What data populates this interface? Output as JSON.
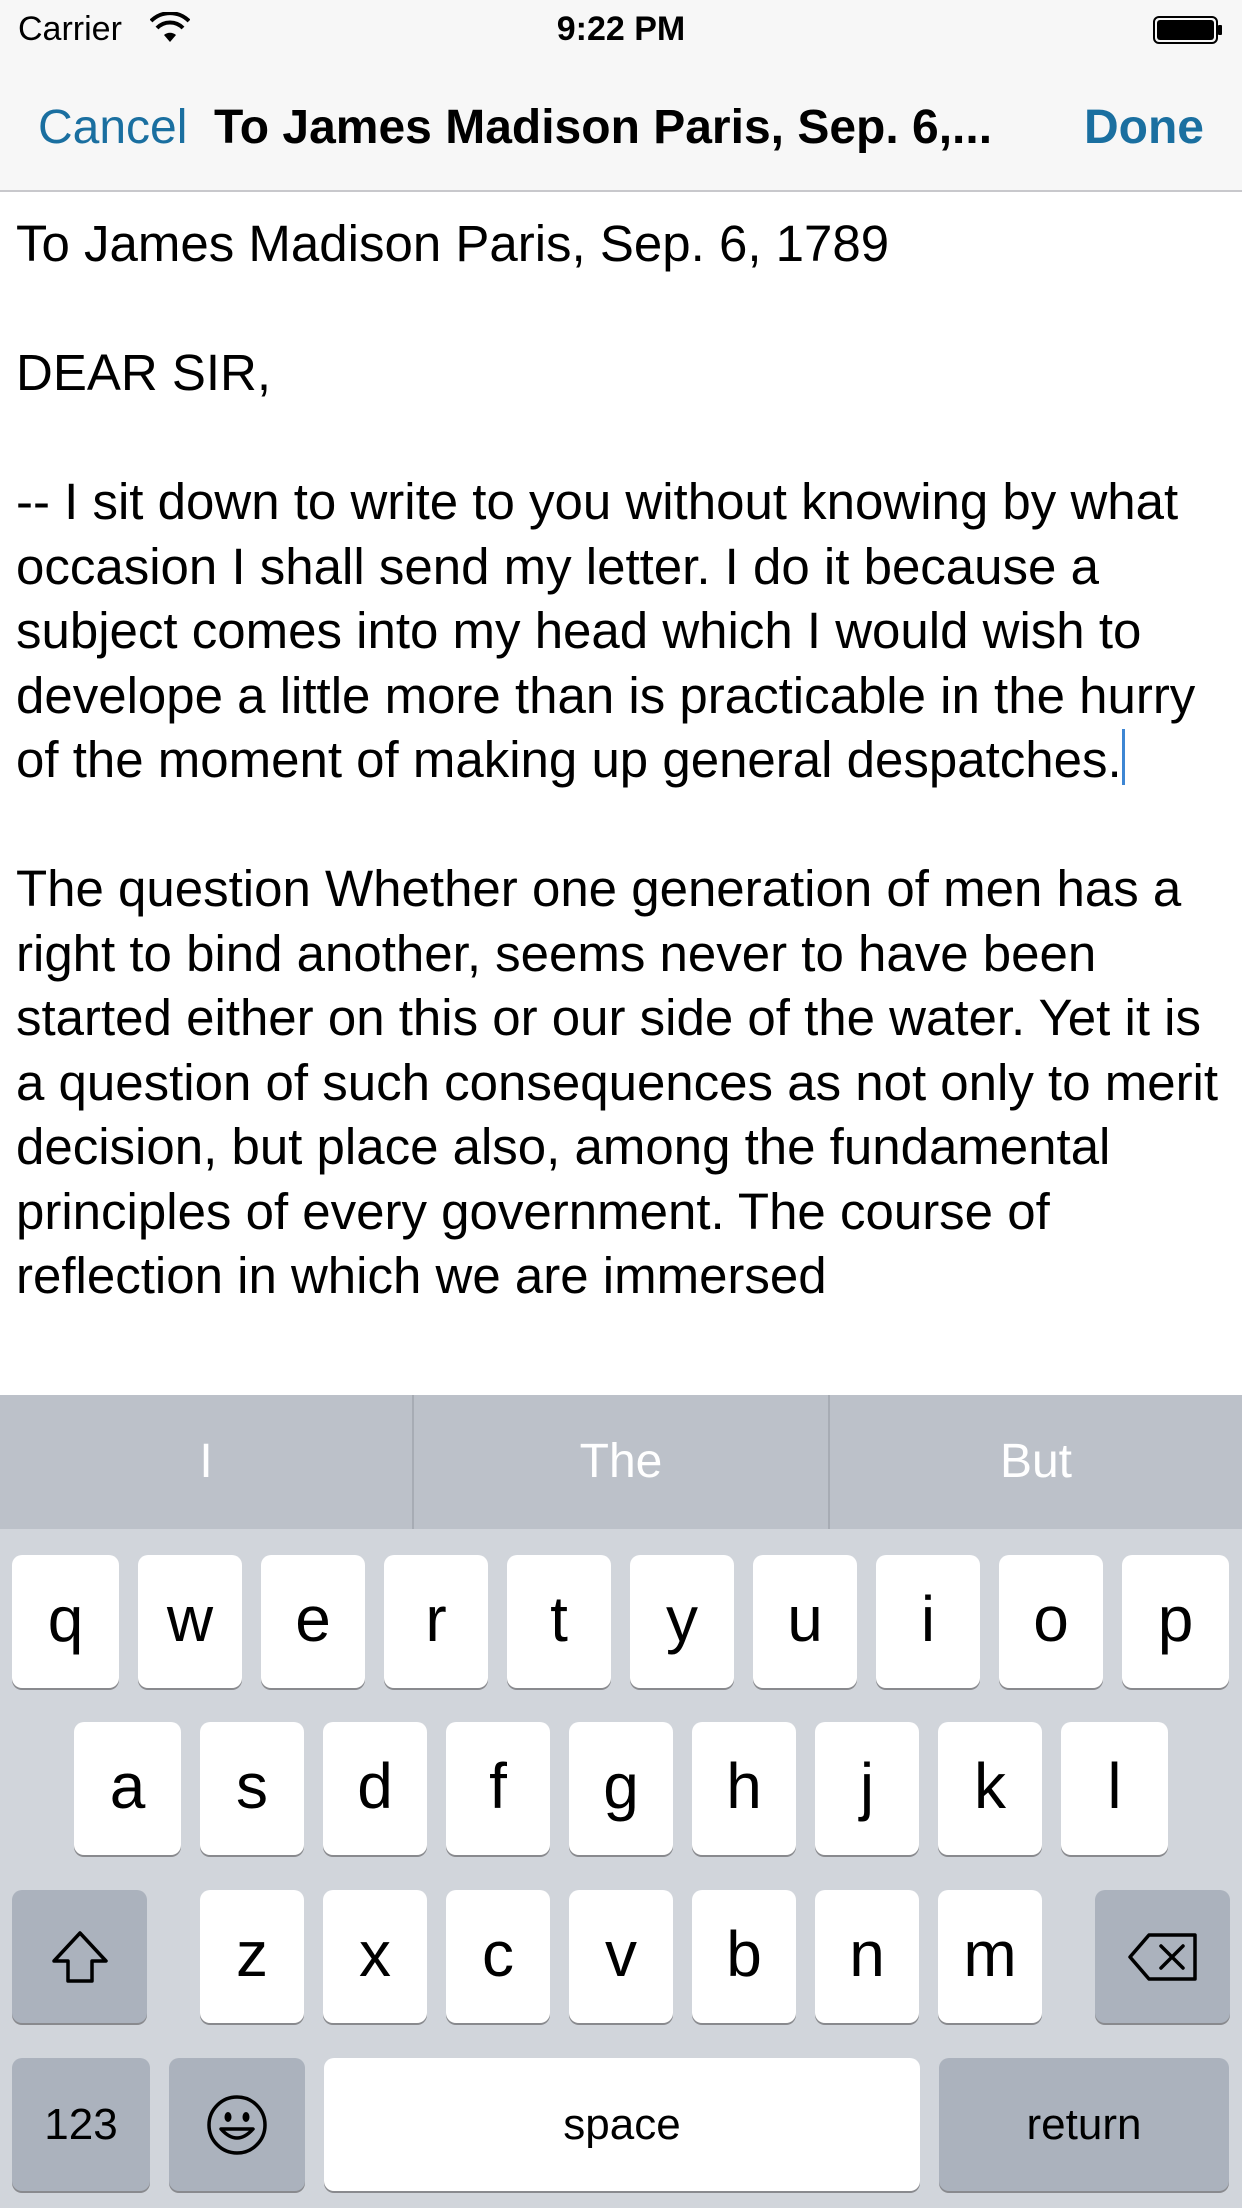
{
  "status_bar": {
    "carrier": "Carrier",
    "time": "9:22 PM"
  },
  "nav": {
    "cancel_label": "Cancel",
    "title": "To James Madison Paris, Sep. 6,...",
    "done_label": "Done"
  },
  "editor": {
    "heading": "To James Madison Paris, Sep. 6, 1789",
    "salutation": "DEAR SIR,",
    "paragraph1": "-- I sit down to write to you without knowing by what occasion I shall send my letter. I do it because a subject comes into my head which I would wish to develope a little more than is practicable in the hurry of the moment of making up general despatches.",
    "paragraph2": "The question Whether one generation of men has a right to bind another, seems never to have been started either on this or our side of the water. Yet it is a question of such consequences as not only to merit decision, but place also, among the fundamental principles of every government. The course of reflection in which we are immersed"
  },
  "keyboard": {
    "suggestions": [
      "I",
      "The",
      "But"
    ],
    "row1": [
      "q",
      "w",
      "e",
      "r",
      "t",
      "y",
      "u",
      "i",
      "o",
      "p"
    ],
    "row2": [
      "a",
      "s",
      "d",
      "f",
      "g",
      "h",
      "j",
      "k",
      "l"
    ],
    "row3": [
      "z",
      "x",
      "c",
      "v",
      "b",
      "n",
      "m"
    ],
    "numbers_label": "123",
    "space_label": "space",
    "return_label": "return"
  },
  "colors": {
    "accent": "#1a6fa0",
    "caret": "#3d86d3",
    "keyboard_bg": "#d1d5db"
  }
}
